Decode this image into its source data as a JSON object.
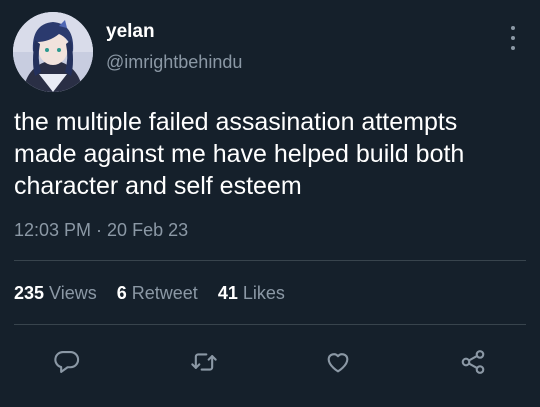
{
  "author": {
    "display_name": "yelan",
    "handle": "@imrightbehindu"
  },
  "tweet": {
    "text": "the multiple failed assasination attempts made against me have helped build both character and self esteem",
    "time": "12:03 PM",
    "separator": " · ",
    "date": "20 Feb 23"
  },
  "stats": {
    "views_count": "235",
    "views_label": "Views",
    "retweets_count": "6",
    "retweets_label": "Retweet",
    "likes_count": "41",
    "likes_label": "Likes"
  },
  "actions": [
    "reply-icon",
    "retweet-icon",
    "like-icon",
    "share-icon"
  ],
  "colors": {
    "background": "#15202b",
    "text": "#ffffff",
    "secondary": "#8b98a5",
    "divider": "#38444d"
  }
}
